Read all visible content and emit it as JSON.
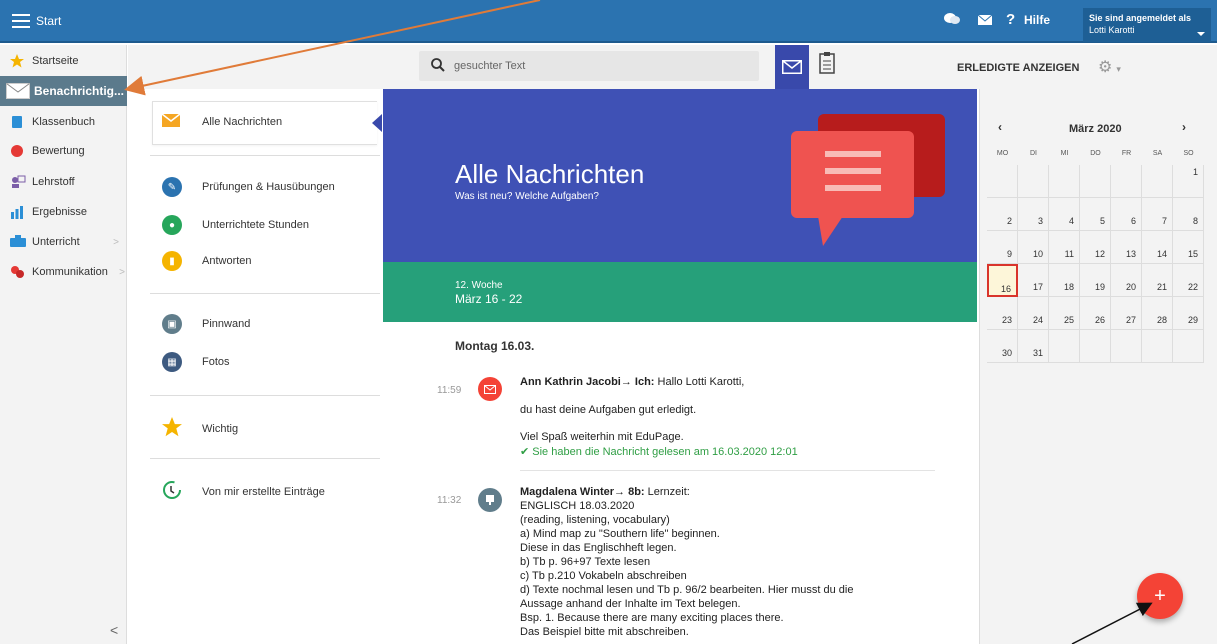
{
  "topbar": {
    "title": "Start",
    "help": "Hilfe",
    "logged_in_label": "Sie sind angemeldet als",
    "user": "Lotti Karotti"
  },
  "sidebar": {
    "items": [
      {
        "label": "Startseite",
        "icon": "star-icon"
      },
      {
        "label": "Benachrichtig...",
        "icon": "mail-icon"
      },
      {
        "label": "Klassenbuch",
        "icon": "book-icon"
      },
      {
        "label": "Bewertung",
        "icon": "grade-icon"
      },
      {
        "label": "Lehrstoff",
        "icon": "teacher-icon"
      },
      {
        "label": "Ergebnisse",
        "icon": "chart-icon"
      },
      {
        "label": "Unterricht",
        "icon": "class-icon"
      },
      {
        "label": "Kommunikation",
        "icon": "people-icon"
      }
    ]
  },
  "toolbar": {
    "search_placeholder": "gesuchter Text",
    "show_done": "ERLEDIGTE ANZEIGEN"
  },
  "filters": [
    {
      "label": "Alle Nachrichten"
    },
    {
      "label": "Prüfungen & Hausübungen"
    },
    {
      "label": "Unterrichtete Stunden"
    },
    {
      "label": "Antworten"
    },
    {
      "label": "Pinnwand"
    },
    {
      "label": "Fotos"
    },
    {
      "label": "Wichtig"
    },
    {
      "label": "Von mir erstellte Einträge"
    }
  ],
  "hero": {
    "title": "Alle Nachrichten",
    "subtitle": "Was ist neu? Welche Aufgaben?"
  },
  "week": {
    "number": "12. Woche",
    "range": "März 16 - 22"
  },
  "feed": {
    "day": "Montag 16.03.",
    "messages": [
      {
        "time": "11:59",
        "sender": "Ann Kathrin Jacobi→ Ich:",
        "first": "Hallo Lotti Karotti,",
        "lines": [
          "du hast deine Aufgaben gut erledigt.",
          "Viel Spaß weiterhin mit EduPage."
        ],
        "read": "Sie haben die Nachricht gelesen am 16.03.2020 12:01",
        "accent": "#f44336"
      },
      {
        "time": "11:32",
        "sender": "Magdalena Winter→ 8b:",
        "first": "Lernzeit:",
        "lines": [
          "ENGLISCH 18.03.2020",
          "(reading, listening, vocabulary)",
          "a) Mind map zu \"Southern life\" beginnen.",
          "Diese in das Englischheft legen.",
          "b) Tb p. 96+97 Texte lesen",
          "c) Tb p.210 Vokabeln abschreiben",
          "d) Texte nochmal lesen und Tb p. 96/2 bearbeiten. Hier musst du die",
          "Aussage anhand der Inhalte im Text belegen.",
          "Bsp. 1. Because there are many exciting places there.",
          "Das Beispiel bitte mit abschreiben."
        ],
        "accent": "#607d8b"
      }
    ]
  },
  "calendar": {
    "month": "März 2020",
    "weekdays": [
      "MO",
      "DI",
      "MI",
      "DO",
      "FR",
      "SA",
      "SO"
    ],
    "weeks": [
      [
        "",
        "",
        "",
        "",
        "",
        "",
        "1"
      ],
      [
        "2",
        "3",
        "4",
        "5",
        "6",
        "7",
        "8"
      ],
      [
        "9",
        "10",
        "11",
        "12",
        "13",
        "14",
        "15"
      ],
      [
        "16",
        "17",
        "18",
        "19",
        "20",
        "21",
        "22"
      ],
      [
        "23",
        "24",
        "25",
        "26",
        "27",
        "28",
        "29"
      ],
      [
        "30",
        "31",
        "",
        "",
        "",
        "",
        ""
      ]
    ],
    "today": "16"
  },
  "colors": {
    "topbar": "#2b73b0",
    "hero": "#3f51b5",
    "week": "#26a07a",
    "fab": "#f44336",
    "annotation": "#e07b39"
  }
}
